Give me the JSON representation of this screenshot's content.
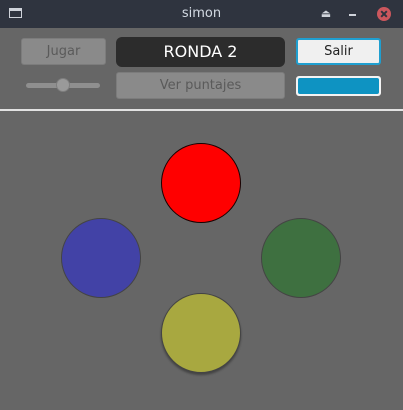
{
  "window": {
    "title": "simon",
    "icons": [
      "app-window-icon",
      "eject-icon",
      "minimize-icon",
      "close-icon"
    ]
  },
  "controls": {
    "play_label": "Jugar",
    "round_label": "RONDA 2",
    "exit_label": "Salir",
    "scores_label": "Ver puntajes",
    "slider_value": 0.5,
    "progress_value": 1.0
  },
  "pads": [
    {
      "name": "red",
      "color": "#ff0000"
    },
    {
      "name": "blue",
      "color": "#4242a6"
    },
    {
      "name": "green",
      "color": "#3e7040"
    },
    {
      "name": "yellow",
      "color": "#a8a840"
    }
  ]
}
